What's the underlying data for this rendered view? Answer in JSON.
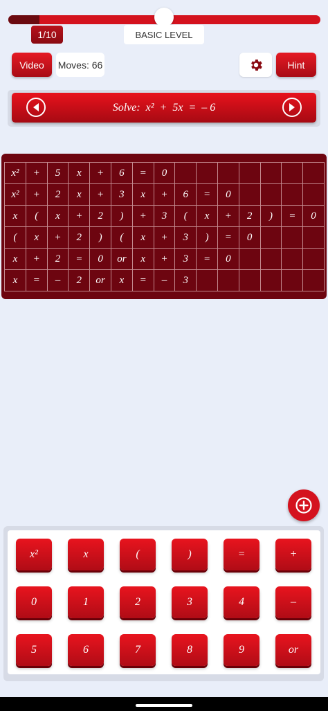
{
  "progress": {
    "fraction": 0.1
  },
  "header": {
    "level_counter": "1/10",
    "level_name": "BASIC LEVEL"
  },
  "toolbar": {
    "video_label": "Video",
    "moves_label": "Moves: 66",
    "settings_icon": "gear-icon",
    "hint_label": "Hint"
  },
  "problem": {
    "text": "Solve:  x²  +  5x  =  – 6",
    "prev_icon": "chevron-left-circle-icon",
    "next_icon": "chevron-right-circle-icon"
  },
  "grid": {
    "columns": 15,
    "rows": [
      [
        "x²",
        "+",
        "5",
        "x",
        "+",
        "6",
        "=",
        "0",
        "",
        "",
        "",
        "",
        "",
        "",
        ""
      ],
      [
        "x²",
        "+",
        "2",
        "x",
        "+",
        "3",
        "x",
        "+",
        "6",
        "=",
        "0",
        "",
        "",
        "",
        ""
      ],
      [
        "x",
        "(",
        "x",
        "+",
        "2",
        ")",
        "+",
        "3",
        "(",
        "x",
        "+",
        "2",
        ")",
        "=",
        "0"
      ],
      [
        "(",
        "x",
        "+",
        "2",
        ")",
        "(",
        "x",
        "+",
        "3",
        ")",
        "=",
        "0",
        "",
        "",
        ""
      ],
      [
        "x",
        "+",
        "2",
        "=",
        "0",
        "or",
        "x",
        "+",
        "3",
        "=",
        "0",
        "",
        "",
        "",
        ""
      ],
      [
        "x",
        "=",
        "–",
        "2",
        "or",
        "x",
        "=",
        "–",
        "3",
        "",
        "",
        "",
        "",
        "",
        ""
      ]
    ]
  },
  "fab": {
    "icon": "plus-circle-icon"
  },
  "keypad": {
    "rows": [
      [
        "x²",
        "x",
        "(",
        ")",
        "=",
        "+"
      ],
      [
        "0",
        "1",
        "2",
        "3",
        "4",
        "–"
      ],
      [
        "5",
        "6",
        "7",
        "8",
        "9",
        "or"
      ]
    ]
  },
  "colors": {
    "accent": "#d4121e",
    "dark_red": "#6d0510",
    "background": "#e9eef9"
  }
}
